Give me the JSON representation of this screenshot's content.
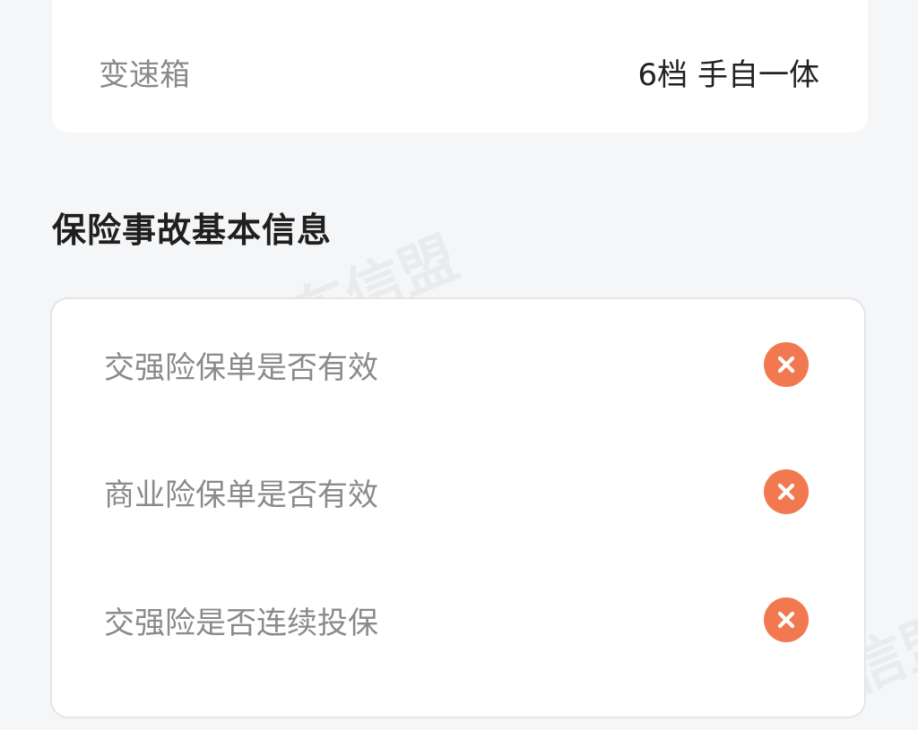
{
  "watermark": {
    "text": "车信盟"
  },
  "vehicle_specs": {
    "items": [
      {
        "label": "变速箱",
        "value": "6档 手自一体"
      }
    ]
  },
  "insurance_section": {
    "title": "保险事故基本信息",
    "items": [
      {
        "label": "交强险保单是否有效",
        "status_icon": "close-icon"
      },
      {
        "label": "商业险保单是否有效",
        "status_icon": "close-icon"
      },
      {
        "label": "交强险是否连续投保",
        "status_icon": "close-icon"
      }
    ]
  },
  "colors": {
    "background": "#f5f6f8",
    "card": "#ffffff",
    "status_negative": "#f2794f",
    "label_text": "#8a8a8a",
    "value_text": "#222222",
    "title_text": "#1f1f1f"
  }
}
